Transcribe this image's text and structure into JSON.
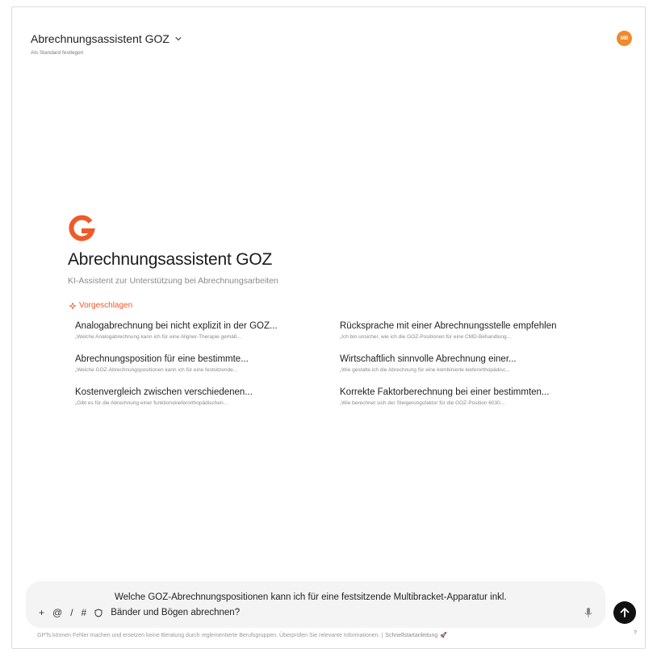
{
  "header": {
    "title": "Abrechnungsassistent GOZ",
    "subtitle": "Als Standard festlegen",
    "avatar_initials": "MB",
    "avatar_color": "#f08a2b"
  },
  "gpt": {
    "name": "Abrechnungsassistent GOZ",
    "description": "KI-Assistent zur Unterstützung bei Abrechnungsarbeiten",
    "logo_color": "#f05a28"
  },
  "suggestions_label": "Vorgeschlagen",
  "suggestions": [
    {
      "title": "Analogabrechnung bei nicht explizit in der GOZ...",
      "subtitle": "„Welche Analogabrechnung kann ich für eine Aligner-Therapie gemäß..."
    },
    {
      "title": "Rücksprache mit einer Abrechnungsstelle empfehlen",
      "subtitle": "„Ich bin unsicher, wie ich die GOZ-Positionen für eine CMD-Behandlung..."
    },
    {
      "title": "Abrechnungsposition für eine bestimmte...",
      "subtitle": "„Welche GOZ-Abrechnungspositionen kann ich für eine festsitzende..."
    },
    {
      "title": "Wirtschaftlich sinnvolle Abrechnung einer...",
      "subtitle": "„Wie gestalte ich die Abrechnung für eine kombinierte kieferorthopädisc..."
    },
    {
      "title": "Kostenvergleich zwischen verschiedenen...",
      "subtitle": "„Gibt es für die Abrechnung einer funktionskieferorthopädischen..."
    },
    {
      "title": "Korrekte Faktorberechnung bei einer bestimmten...",
      "subtitle": "„Wie berechnet sich der Steigerungsfaktor für die GOZ-Position 6030..."
    }
  ],
  "composer": {
    "line1": "Welche GOZ-Abrechnungspositionen kann ich für eine festsitzende Multibracket-Apparatur inkl.",
    "line2": "Bänder und Bögen abrechnen?",
    "tools": [
      "+",
      "@",
      "/",
      "#"
    ]
  },
  "footer": {
    "text": "GPTs können Fehler machen und ersetzen keine Beratung durch reglementierte Berufsgruppen. Überprüfen Sie relevante Informationen. |",
    "link": "Schnellstartanleitung",
    "help": "?"
  }
}
